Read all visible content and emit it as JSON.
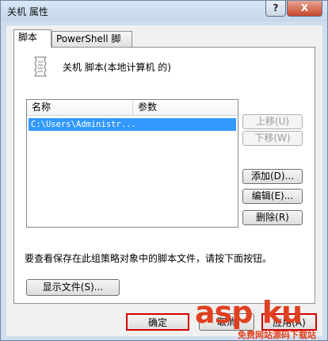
{
  "window": {
    "title": "关机 属性",
    "help_label": "?",
    "close_label": "X"
  },
  "tabs": [
    {
      "label": "脚本",
      "selected": true
    },
    {
      "label": "PowerShell 脚本",
      "selected": false
    }
  ],
  "header": {
    "icon": "script-document-icon",
    "text": "关机 脚本(本地计算机 的)"
  },
  "list": {
    "columns": [
      "名称",
      "参数"
    ],
    "rows": [
      {
        "name": "C:\\Users\\Administr...",
        "params": ""
      }
    ]
  },
  "side_buttons": {
    "up": "上移(U)",
    "down": "下移(W)",
    "add": "添加(D)...",
    "edit": "编辑(E)...",
    "remove": "删除(R)"
  },
  "info_text": "要查看保存在此组策略对象中的脚本文件，请按下面按钮。",
  "show_files_label": "显示文件(S)...",
  "footer": {
    "ok": "确定",
    "cancel": "取消",
    "apply": "应用(A)"
  },
  "watermark": {
    "big": "asp ku",
    "small": "免费网站源码下载站"
  },
  "colors": {
    "selection": "#3399ff",
    "highlight_box": "#d10000",
    "watermark": "#e04020"
  }
}
